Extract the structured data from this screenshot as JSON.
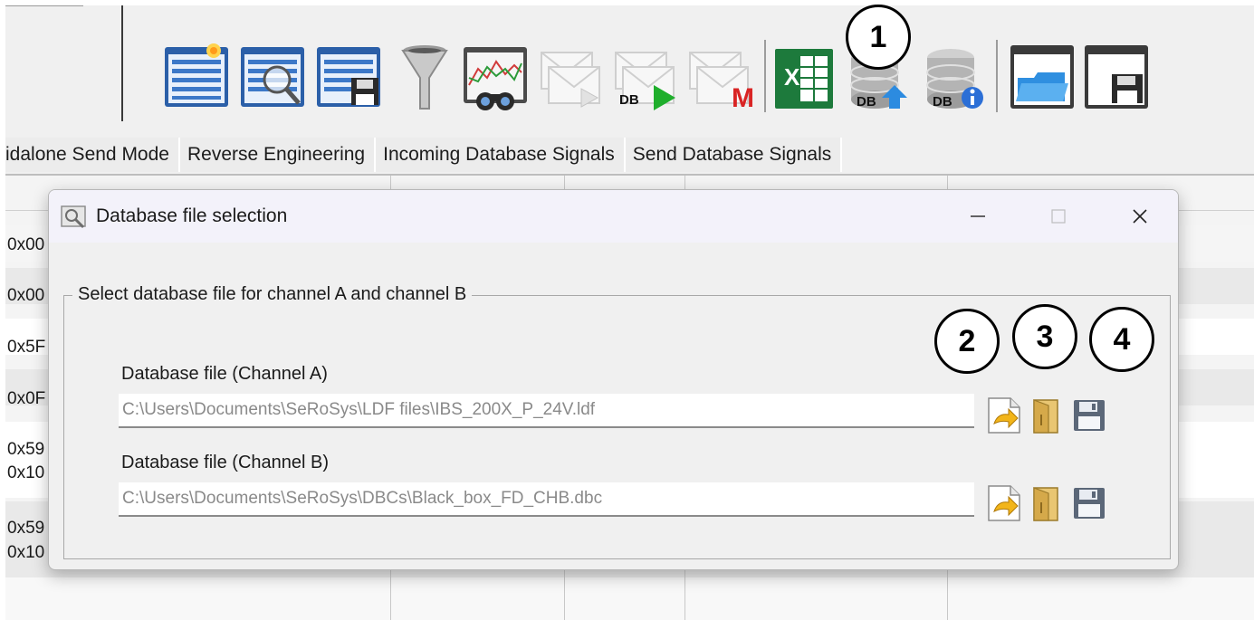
{
  "tabs": [
    {
      "label": "idalone Send Mode"
    },
    {
      "label": "Reverse Engineering"
    },
    {
      "label": "Incoming Database Signals"
    },
    {
      "label": "Send Database Signals"
    }
  ],
  "toolbar": {
    "icons": [
      "new-list-icon",
      "search-list-icon",
      "save-list-icon",
      "filter-icon",
      "signal-binoculars-icon",
      "message-send-icon",
      "db-message-send-icon",
      "mail-icon",
      "excel-icon",
      "db-upload-icon",
      "db-info-icon",
      "open-folder-icon",
      "save-window-icon"
    ],
    "db_label": "DB",
    "excel_label": "X",
    "mail_label": "M"
  },
  "callouts": [
    "1",
    "2",
    "3",
    "4"
  ],
  "grid": {
    "cells": [
      "0x00",
      "0x00",
      "0x5F",
      "0x0F",
      "0x59",
      "0x10",
      "0x59",
      "0x10"
    ]
  },
  "dialog": {
    "title": "Database file selection",
    "group_label": "Select database file for channel A and channel B",
    "channel_a": {
      "label": "Database file (Channel A)",
      "value": "C:\\Users\\Documents\\SeRoSys\\LDF files\\IBS_200X_P_24V.ldf"
    },
    "channel_b": {
      "label": "Database file (Channel B)",
      "value": "C:\\Users\\Documents\\SeRoSys\\DBCs\\Black_box_FD_CHB.dbc"
    },
    "window_controls": [
      "minimize-icon",
      "maximize-icon",
      "close-icon"
    ]
  },
  "colors": {
    "excel_green": "#1d7a3c",
    "play_green": "#1fae2c",
    "mail_red": "#d92424",
    "list_blue": "#2f6fc0",
    "db_blue": "#2c8be0"
  }
}
